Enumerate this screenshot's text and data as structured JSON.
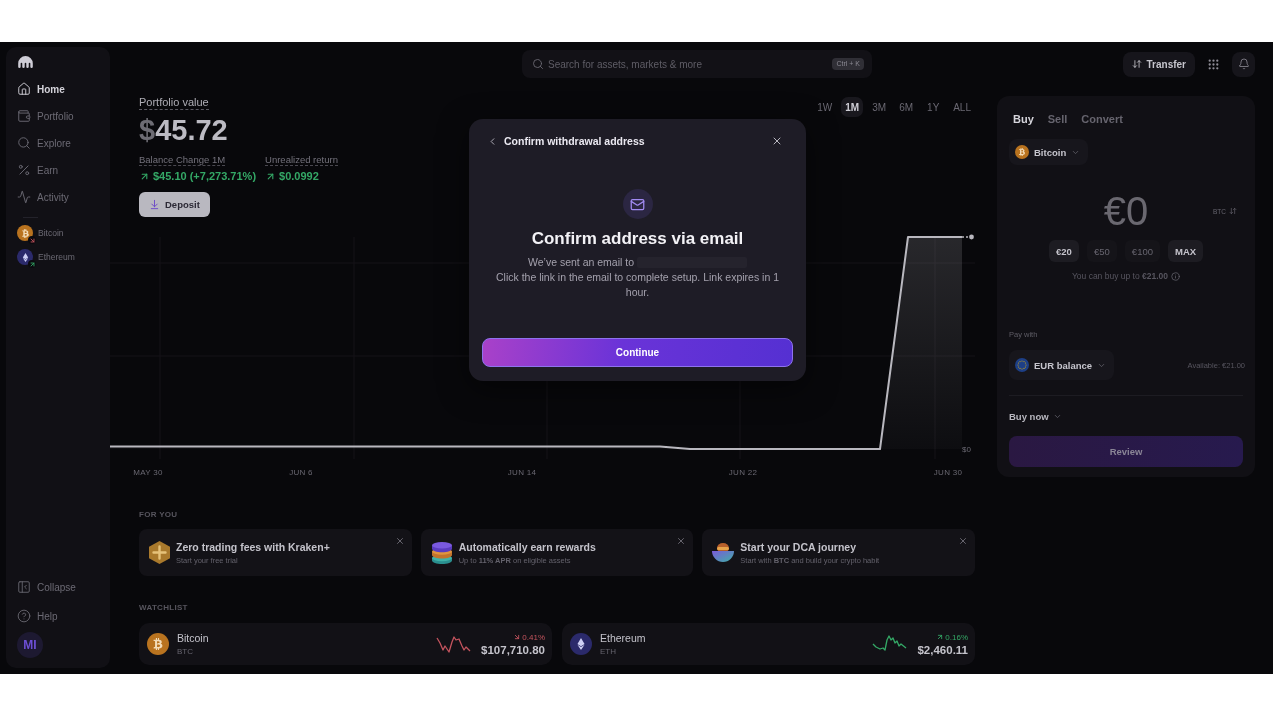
{
  "sidebar": {
    "nav": [
      {
        "label": "Home",
        "selected": true
      },
      {
        "label": "Portfolio",
        "selected": false
      },
      {
        "label": "Explore",
        "selected": false
      },
      {
        "label": "Earn",
        "selected": false
      },
      {
        "label": "Activity",
        "selected": false
      }
    ],
    "assets": [
      {
        "name": "Bitcoin",
        "rising": false
      },
      {
        "name": "Ethereum",
        "rising": true
      }
    ],
    "footer": [
      "Collapse",
      "Help"
    ],
    "avatar": "MI"
  },
  "search": {
    "placeholder": "Search for assets, markets & more",
    "shortcut": "Ctrl + K"
  },
  "top_actions": {
    "transfer": "Transfer"
  },
  "portfolio": {
    "label": "Portfolio value",
    "value": "$45.72",
    "stats": [
      {
        "label": "Balance Change 1M",
        "value": "$45.10 (+7,273.71%)",
        "rising": true
      },
      {
        "label": "Unrealized return",
        "value": "$0.0992",
        "rising": true
      }
    ],
    "deposit": "Deposit"
  },
  "timeframes": [
    {
      "label": "1W",
      "selected": false
    },
    {
      "label": "1M",
      "selected": true
    },
    {
      "label": "3M",
      "selected": false
    },
    {
      "label": "6M",
      "selected": false
    },
    {
      "label": "1Y",
      "selected": false
    },
    {
      "label": "ALL",
      "selected": false
    }
  ],
  "chart": {
    "date_labels": [
      "MAY 30",
      "JUN 6",
      "JUN 14",
      "JUN 22",
      "JUN 30"
    ],
    "y_label": "$0"
  },
  "for_you": {
    "title": "FOR YOU",
    "cards": [
      {
        "kind": "plus",
        "title": "Zero trading fees with Kraken**+**",
        "subtitle": "Start your free trial"
      },
      {
        "kind": "rewards",
        "title": "Automatically earn rewards",
        "subtitle": "Up to **11% APR** on eligible assets"
      },
      {
        "kind": "recurring",
        "title": "Start your DCA journey",
        "subtitle": "Start with **BTC** and build your crypto habit"
      }
    ]
  },
  "watchlist": {
    "title": "WATCHLIST",
    "rows": [
      {
        "name": "Bitcoin",
        "ticker": "BTC",
        "change": "0.41%",
        "rising": false,
        "price": "$107,710.80"
      },
      {
        "name": "Ethereum",
        "ticker": "ETH",
        "change": "0.16%",
        "rising": true,
        "price": "$2,460.11"
      }
    ]
  },
  "trade_panel": {
    "tabs": [
      {
        "label": "Buy",
        "selected": true
      },
      {
        "label": "Sell",
        "selected": false
      },
      {
        "label": "Convert",
        "selected": false
      }
    ],
    "asset": "Bitcoin",
    "amount": "€0",
    "unit": "BTC",
    "presets": [
      {
        "label": "€20",
        "disabled": false
      },
      {
        "label": "€50",
        "disabled": true
      },
      {
        "label": "€100",
        "disabled": true
      },
      {
        "label": "MAX",
        "disabled": false
      }
    ],
    "limit": "You can buy up to **€21.00**",
    "pay_with_label": "Pay with",
    "pay_method": "EUR balance",
    "available": "Available: €21.00",
    "order_type": "Buy now",
    "review": {
      "label": "Review",
      "disabled": true
    }
  },
  "dialog": {
    "title": "Confirm withdrawal address",
    "heading": "Confirm address via email",
    "sent_text": "We’ve sent an email to",
    "instructions": "Click the link in the email to complete setup. Link expires in 1 hour.",
    "button": "Continue"
  }
}
